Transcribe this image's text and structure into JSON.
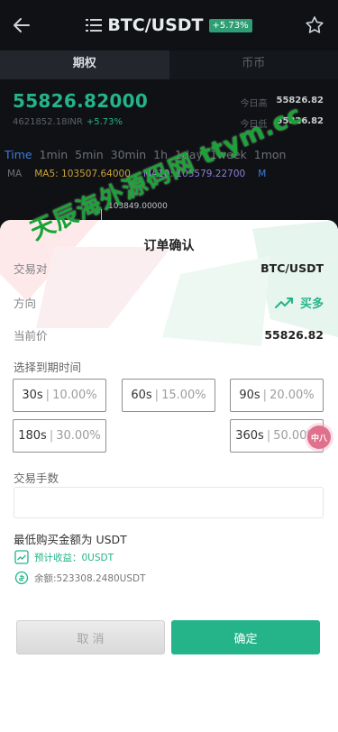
{
  "header": {
    "title": "BTC/USDT",
    "change_badge": "+5.73%"
  },
  "tabs": [
    {
      "label": "期权"
    },
    {
      "label": "币币"
    }
  ],
  "price": {
    "current": "55826.82000",
    "secondary": "4621852.18INR",
    "change": "+5.73%",
    "high_label": "今日高",
    "high_value": "55826.82",
    "low_label": "今日低",
    "low_value": "55826.82"
  },
  "intervals": [
    "Time",
    "1min",
    "5min",
    "30min",
    "1h",
    "1day",
    "1week",
    "1mon"
  ],
  "ma": {
    "label": "MA",
    "ma5": "MA5: 103507.64000",
    "ma10": "MA10: 103579.22700",
    "m": "M"
  },
  "chart": {
    "top_value": "103849.00000"
  },
  "modal": {
    "title": "订单确认",
    "pair_label": "交易对",
    "pair_value": "BTC/USDT",
    "direction_label": "方向",
    "direction_value": "买多",
    "current_price_label": "当前价",
    "current_price_value": "55826.82",
    "expiry_label": "选择到期时间",
    "options": [
      {
        "time": "30s",
        "rate": "10.00%"
      },
      {
        "time": "60s",
        "rate": "15.00%"
      },
      {
        "time": "90s",
        "rate": "20.00%"
      },
      {
        "time": "180s",
        "rate": "30.00%"
      },
      {
        "time": "360s",
        "rate": "50.00%"
      }
    ],
    "fee_label": "交易手数",
    "fee_value": "",
    "min_buy": "最低购买金额为 USDT",
    "expected_profit": "预计收益：0USDT",
    "balance": "余额:523308.2480USDT",
    "cancel_label": "取 消",
    "confirm_label": "确定"
  },
  "watermark": "天辰海外源码网 ttym.cc",
  "float_badge": "中八",
  "colors": {
    "accent": "#25b48a",
    "watermark": "#1aa336",
    "interval_active": "#3e7bdf"
  }
}
